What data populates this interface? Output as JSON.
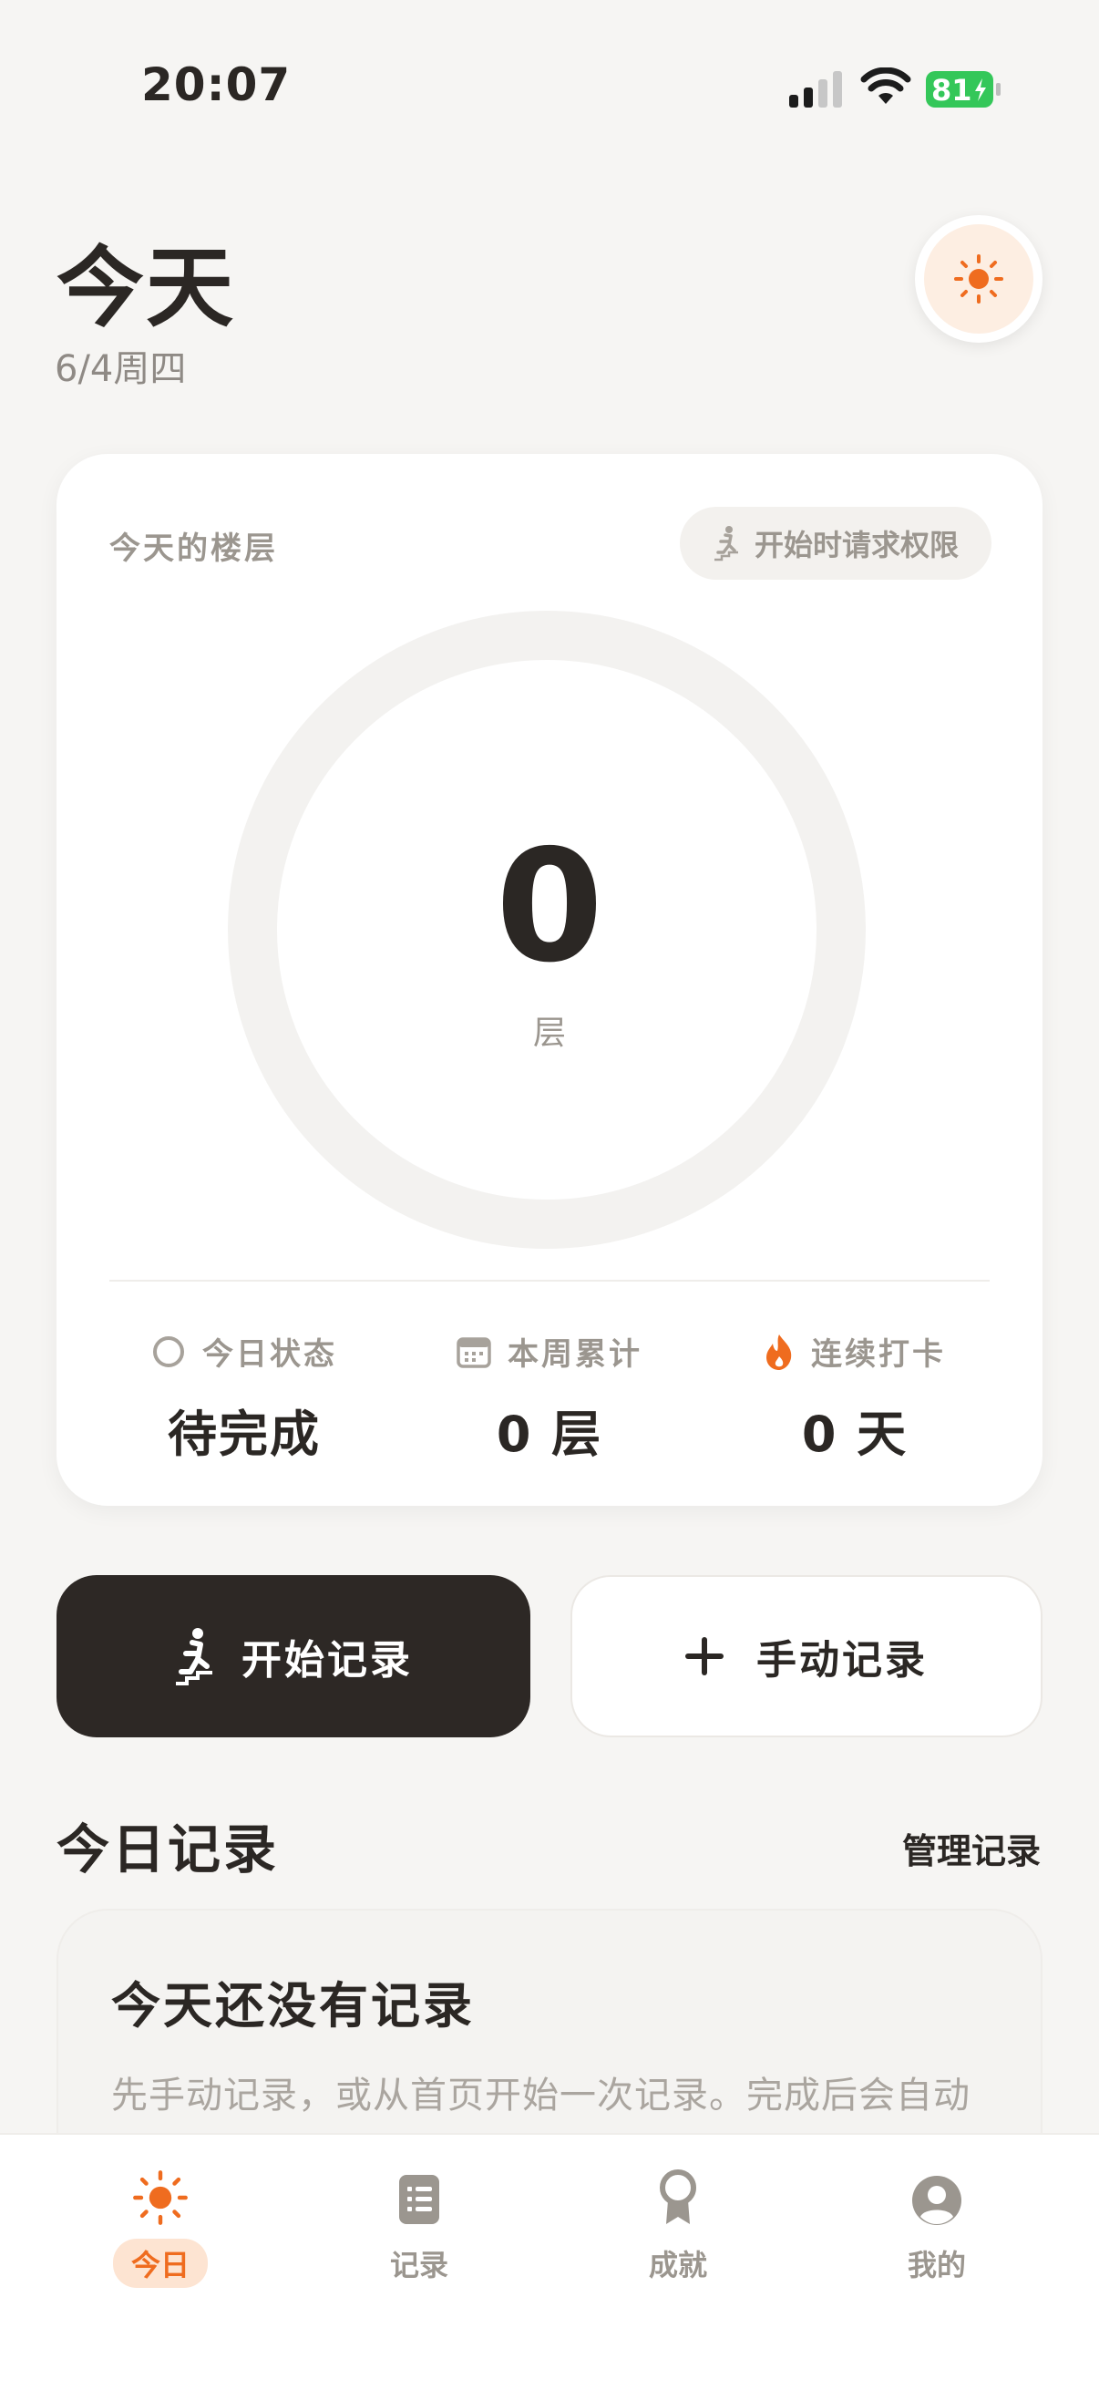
{
  "status_bar": {
    "time": "20:07",
    "battery": "81"
  },
  "header": {
    "title": "今天",
    "date": "6/4周四"
  },
  "card": {
    "label": "今天的楼层",
    "permission_pill": "开始时请求权限",
    "floors": "0",
    "unit": "层",
    "stats": [
      {
        "label": "今日状态",
        "value": "待完成",
        "icon": "circle-outline-icon"
      },
      {
        "label": "本周累计",
        "value": "0 层",
        "icon": "calendar-icon"
      },
      {
        "label": "连续打卡",
        "value": "0 天",
        "icon": "flame-icon"
      }
    ]
  },
  "actions": {
    "start": "开始记录",
    "manual": "手动记录"
  },
  "today_records": {
    "title": "今日记录",
    "manage": "管理记录",
    "empty_title": "今天还没有记录",
    "empty_desc": "先手动记录，或从首页开始一次记录。完成后会自动出现在这里。"
  },
  "tabs": [
    {
      "label": "今日",
      "icon": "sun-icon",
      "active": true
    },
    {
      "label": "记录",
      "icon": "list-icon",
      "active": false
    },
    {
      "label": "成就",
      "icon": "medal-icon",
      "active": false
    },
    {
      "label": "我的",
      "icon": "user-icon",
      "active": false
    }
  ],
  "colors": {
    "accent": "#ef6c1f",
    "dark": "#2d2825",
    "battery": "#34c759"
  }
}
